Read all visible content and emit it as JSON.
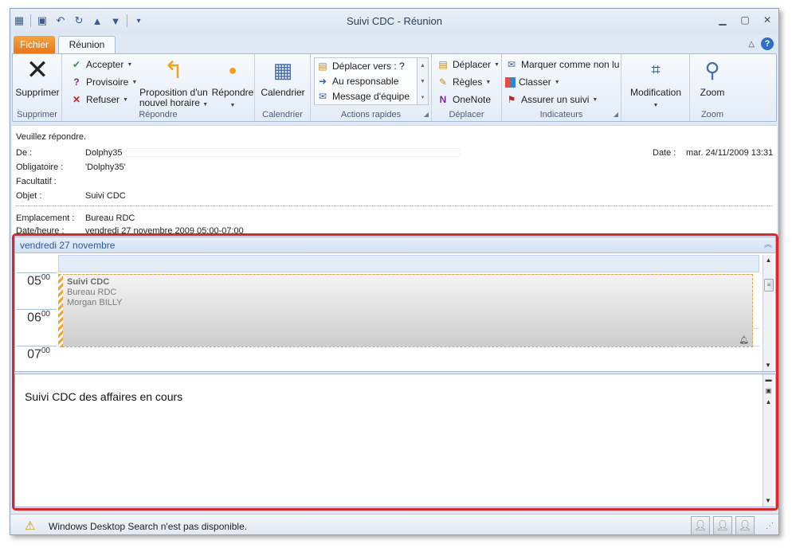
{
  "window": {
    "title": "Suivi CDC  -  Réunion"
  },
  "qat": {
    "icons": [
      "calendar-app-icon",
      "save-icon",
      "undo-icon",
      "redo-icon",
      "previous-icon",
      "next-icon",
      "customize-icon"
    ]
  },
  "tabs": {
    "file": "Fichier",
    "active": "Réunion"
  },
  "ribbon": {
    "groups": {
      "supprimer": {
        "label": "Supprimer",
        "delete": "Supprimer"
      },
      "repondre": {
        "label": "Répondre",
        "accept": "Accepter",
        "tentative": "Provisoire",
        "decline": "Refuser",
        "propose_line1": "Proposition d'un",
        "propose_line2": "nouvel horaire",
        "reply": "Répondre"
      },
      "calendrier": {
        "label": "Calendrier",
        "calendar": "Calendrier"
      },
      "actions_rapides": {
        "label": "Actions rapides",
        "items": [
          "Déplacer vers : ?",
          "Au responsable",
          "Message d'équipe"
        ]
      },
      "deplacer": {
        "label": "Déplacer",
        "move": "Déplacer",
        "rules": "Règles",
        "onenote": "OneNote"
      },
      "indicateurs": {
        "label": "Indicateurs",
        "mark_unread": "Marquer comme non lu",
        "categorize": "Classer",
        "follow_up": "Assurer un suivi"
      },
      "modification": {
        "label": "Modification"
      },
      "zoom": {
        "label": "Zoom",
        "zoom": "Zoom"
      }
    }
  },
  "header": {
    "notice": "Veuillez répondre.",
    "from_label": "De :",
    "from_value": "Dolphy35",
    "date_label": "Date :",
    "date_value": "mar. 24/11/2009 13:31",
    "required_label": "Obligatoire :",
    "required_value": "'Dolphy35'",
    "optional_label": "Facultatif :",
    "subject_label": "Objet :",
    "subject_value": "Suivi CDC",
    "location_label": "Emplacement :",
    "location_value": "Bureau RDC",
    "datetime_label": "Date/heure :",
    "datetime_value": "vendredi 27 novembre 2009 05:00-07:00"
  },
  "calendar": {
    "day_header": "vendredi 27 novembre",
    "hours": [
      {
        "h": "05",
        "m": "00"
      },
      {
        "h": "06",
        "m": "00"
      },
      {
        "h": "07",
        "m": "00"
      }
    ],
    "event": {
      "title": "Suivi CDC",
      "location": "Bureau RDC",
      "organizer": "Morgan BILLY"
    }
  },
  "body": {
    "text": "Suivi CDC des affaires en cours"
  },
  "status": {
    "message": "Windows Desktop Search n'est pas disponible."
  },
  "colors": {
    "accent_file_tab": "#e5781c",
    "annotation_red": "#d8262b",
    "event_border": "#e8a33a",
    "day_header_text": "#2d5a99"
  }
}
